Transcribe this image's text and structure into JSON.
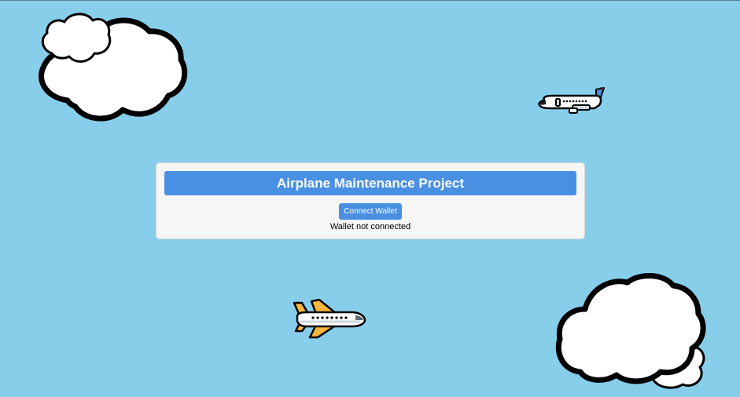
{
  "app": {
    "title": "Airplane Maintenance Project"
  },
  "wallet": {
    "connect_label": "Connect Wallet",
    "status": "Wallet not connected"
  },
  "colors": {
    "sky": "#87ceeb",
    "accent": "#4a90e2",
    "panel": "#f6f6f6"
  },
  "decorations": {
    "icons": [
      "cloud-icon",
      "airplane-icon"
    ]
  }
}
